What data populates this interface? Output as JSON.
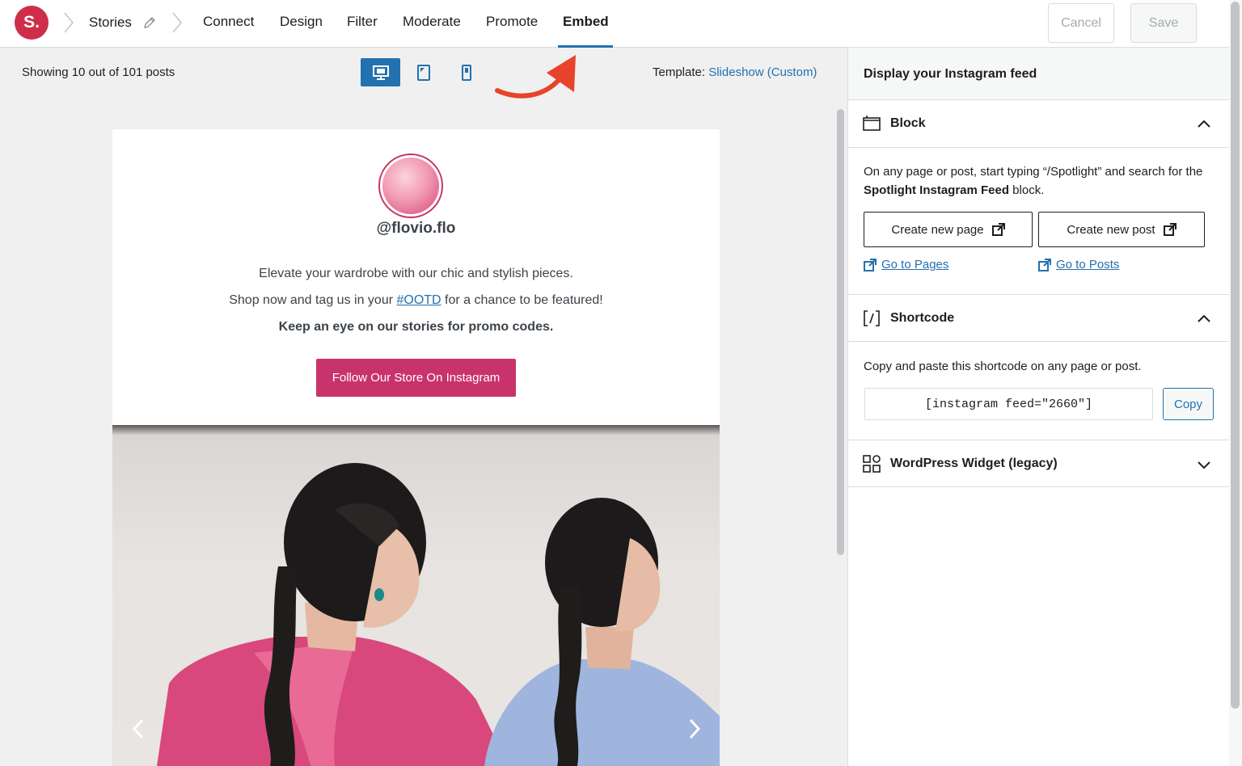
{
  "topbar": {
    "logo_text": "S.",
    "crumb": "Stories",
    "nav": [
      "Connect",
      "Design",
      "Filter",
      "Moderate",
      "Promote",
      "Embed"
    ],
    "active_nav": "Embed",
    "cancel_label": "Cancel",
    "save_label": "Save"
  },
  "preview": {
    "showing": "Showing 10 out of 101 posts",
    "devices": [
      "desktop",
      "tablet",
      "phone"
    ],
    "active_device": "desktop",
    "template_label": "Template:",
    "template_value": "Slideshow (Custom)"
  },
  "feed": {
    "handle": "@flovio.flo",
    "bio_line1": "Elevate your wardrobe with our chic and stylish pieces.",
    "bio_line2_before": "Shop now and tag us in your ",
    "bio_hashtag": "#OOTD",
    "bio_line2_after": " for a chance to be featured!",
    "bio_line3": "Keep an eye on our stories for promo codes.",
    "follow_label": "Follow Our Store On Instagram"
  },
  "panel": {
    "title": "Display your Instagram feed",
    "block": {
      "title": "Block",
      "desc_part1": "On any page or post, start typing “/Spotlight” and search for the ",
      "desc_bold": "Spotlight Instagram Feed",
      "desc_part2": " block.",
      "create_page": "Create new page",
      "create_post": "Create new post",
      "go_pages": "Go to Pages",
      "go_posts": "Go to Posts"
    },
    "shortcode": {
      "title": "Shortcode",
      "desc": "Copy and paste this shortcode on any page or post.",
      "code": "[instagram feed=\"2660\"]",
      "copy_label": "Copy"
    },
    "widget": {
      "title": "WordPress Widget (legacy)"
    }
  },
  "colors": {
    "accent": "#2271b1",
    "brand": "#cf2e4a",
    "follow_button": "#c8336b",
    "annotation_arrow": "#e8432b"
  }
}
